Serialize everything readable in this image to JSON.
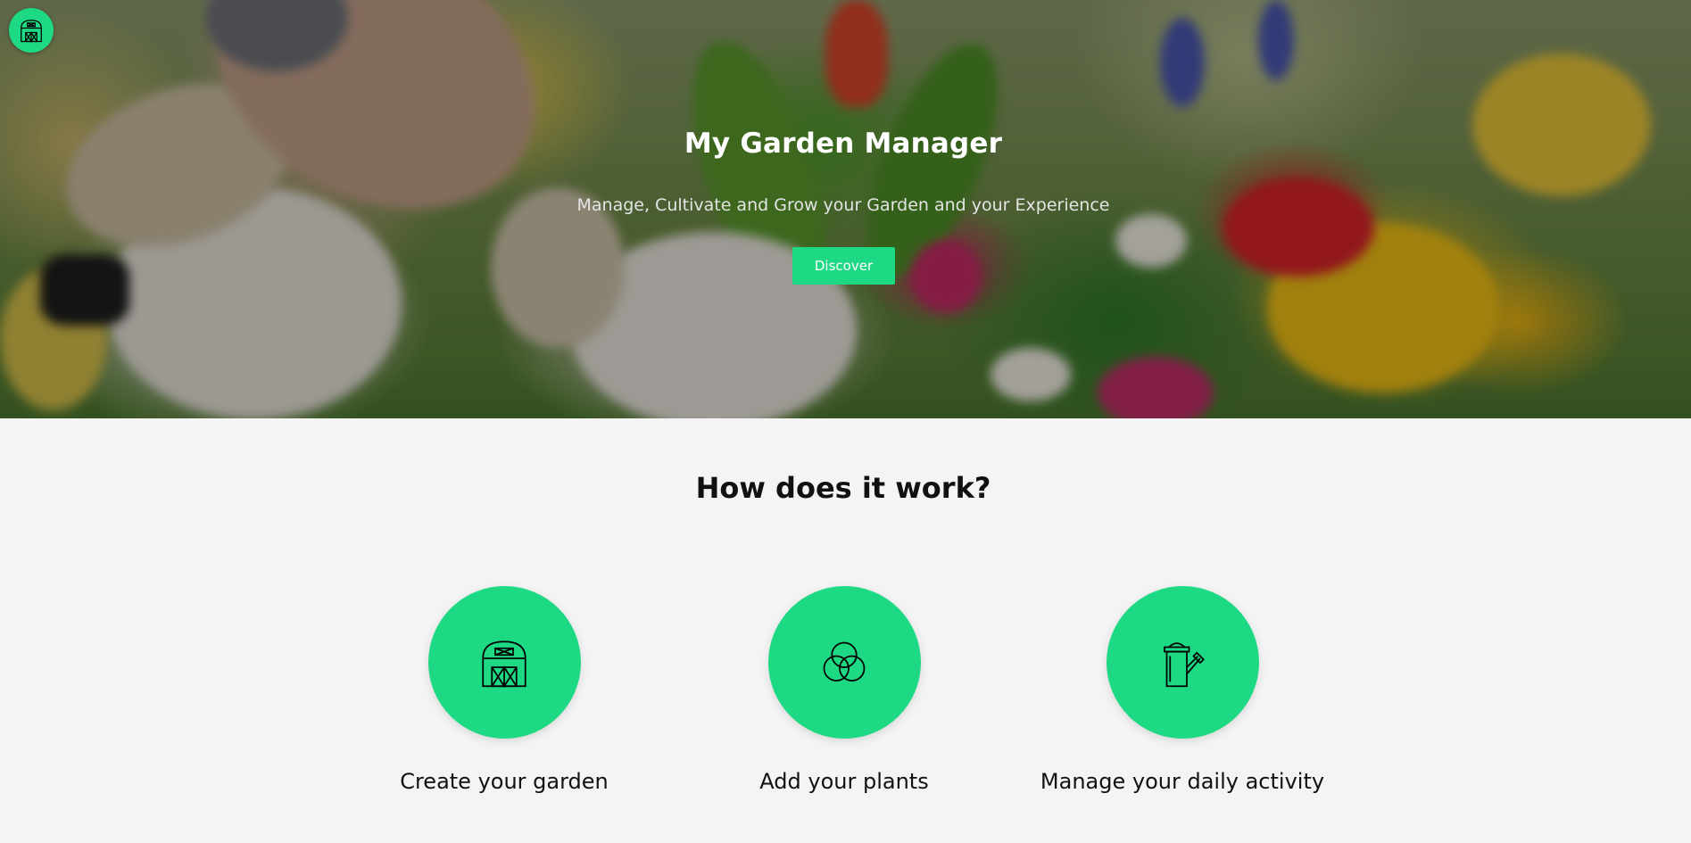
{
  "app": {
    "title": "My Garden Manager",
    "subtitle": "Manage, Cultivate and Grow your Garden and your Experience",
    "cta_label": "Discover",
    "logo_icon": "barn-icon"
  },
  "how": {
    "title": "How does it work?",
    "steps": [
      {
        "label": "Create your garden",
        "icon": "barn-icon"
      },
      {
        "label": "Add your plants",
        "icon": "overlapping-circles-icon"
      },
      {
        "label": "Manage your daily activity",
        "icon": "watering-can-icon"
      }
    ]
  },
  "colors": {
    "accent": "#1ed984",
    "background": "#f4f4f4",
    "text": "#111111"
  }
}
